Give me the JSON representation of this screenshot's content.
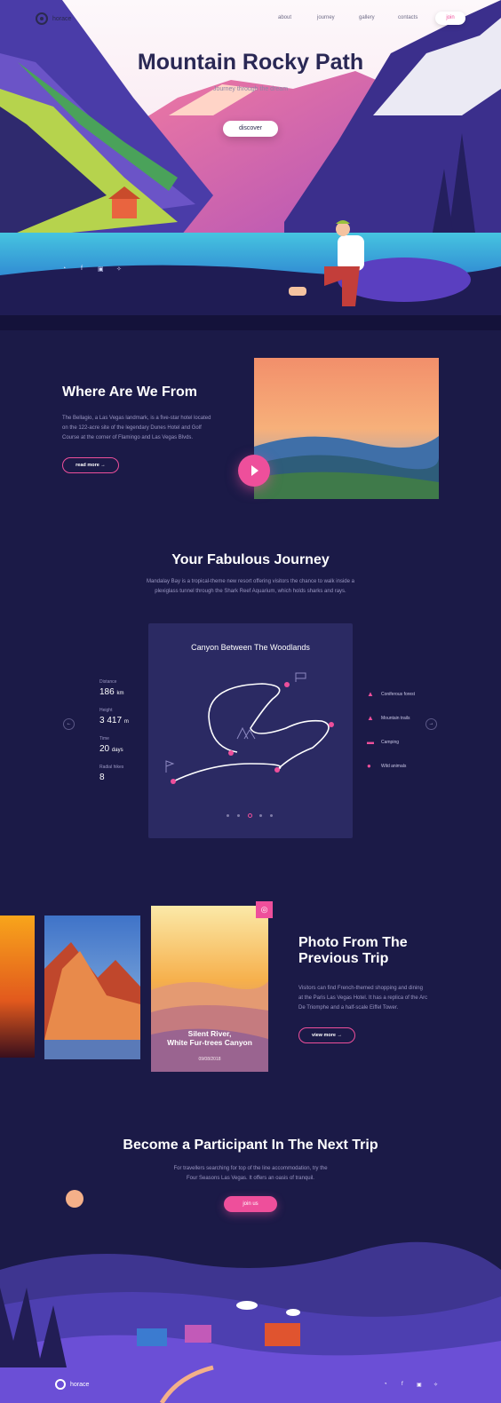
{
  "brand": {
    "name": "horace"
  },
  "nav": {
    "items": [
      "about",
      "journey",
      "gallery",
      "contacts"
    ],
    "join": "join"
  },
  "hero": {
    "title": "Mountain Rocky Path",
    "subtitle": "Journey through the dream",
    "cta": "discover",
    "social": [
      "rss-icon",
      "facebook-icon",
      "instagram-icon",
      "twitter-icon"
    ]
  },
  "about": {
    "title": "Where Are We From",
    "text": [
      "The Bellagio, a Las Vegas landmark, is a five-star hotel located",
      "on the 122-acre site of the legendary Dunes Hotel and Golf",
      "Course at the corner of Flamingo and Las Vegas Blvds."
    ],
    "button": "read more"
  },
  "journey": {
    "title": "Your Fabulous Journey",
    "text": [
      "Mandalay Bay is a tropical-theme new resort offering visitors the chance to walk inside a",
      "plexiglass tunnel through the Shark Reef Aquarium, which holds sharks and rays."
    ],
    "card_title": "Canyon Between The Woodlands",
    "stats": [
      {
        "label": "Distance",
        "value": "186",
        "unit": "km"
      },
      {
        "label": "Height",
        "value": "3 417",
        "unit": "m"
      },
      {
        "label": "Time",
        "value": "20",
        "unit": "days"
      },
      {
        "label": "Radial hikes",
        "value": "8",
        "unit": ""
      }
    ],
    "features": [
      {
        "icon": "tree-icon",
        "label": "Coniferous forest"
      },
      {
        "icon": "mountain-icon",
        "label": "Mountain trails"
      },
      {
        "icon": "car-icon",
        "label": "Camping"
      },
      {
        "icon": "animal-icon",
        "label": "Wild animals"
      }
    ],
    "active_slide": 3,
    "slides": 5
  },
  "gallery": {
    "title_lines": [
      "Photo From The",
      "Previous Trip"
    ],
    "text": [
      "Visitors can find French-themed shopping and dining",
      "at the Paris Las Vegas Hotel. It has a replica of the Arc",
      "De Triomphe and a half-scale Eiffel Tower."
    ],
    "button": "view more",
    "featured": {
      "title_lines": [
        "Silent River,",
        "White Fur-trees Canyon"
      ],
      "date": "09/08/2018"
    }
  },
  "participate": {
    "title": "Become a Participant In The Next Trip",
    "text": [
      "For travellers searching for top of the line accommodation, try the",
      "Four Seasons Las Vegas. It offers an oasis of tranquil."
    ],
    "button": "join us"
  },
  "footer": {
    "brand": "horace",
    "social": [
      "rss-icon",
      "facebook-icon",
      "instagram-icon",
      "twitter-icon"
    ]
  },
  "colors": {
    "accent": "#ee4f9b",
    "bg": "#1b1a47",
    "card": "#2b2a63"
  }
}
